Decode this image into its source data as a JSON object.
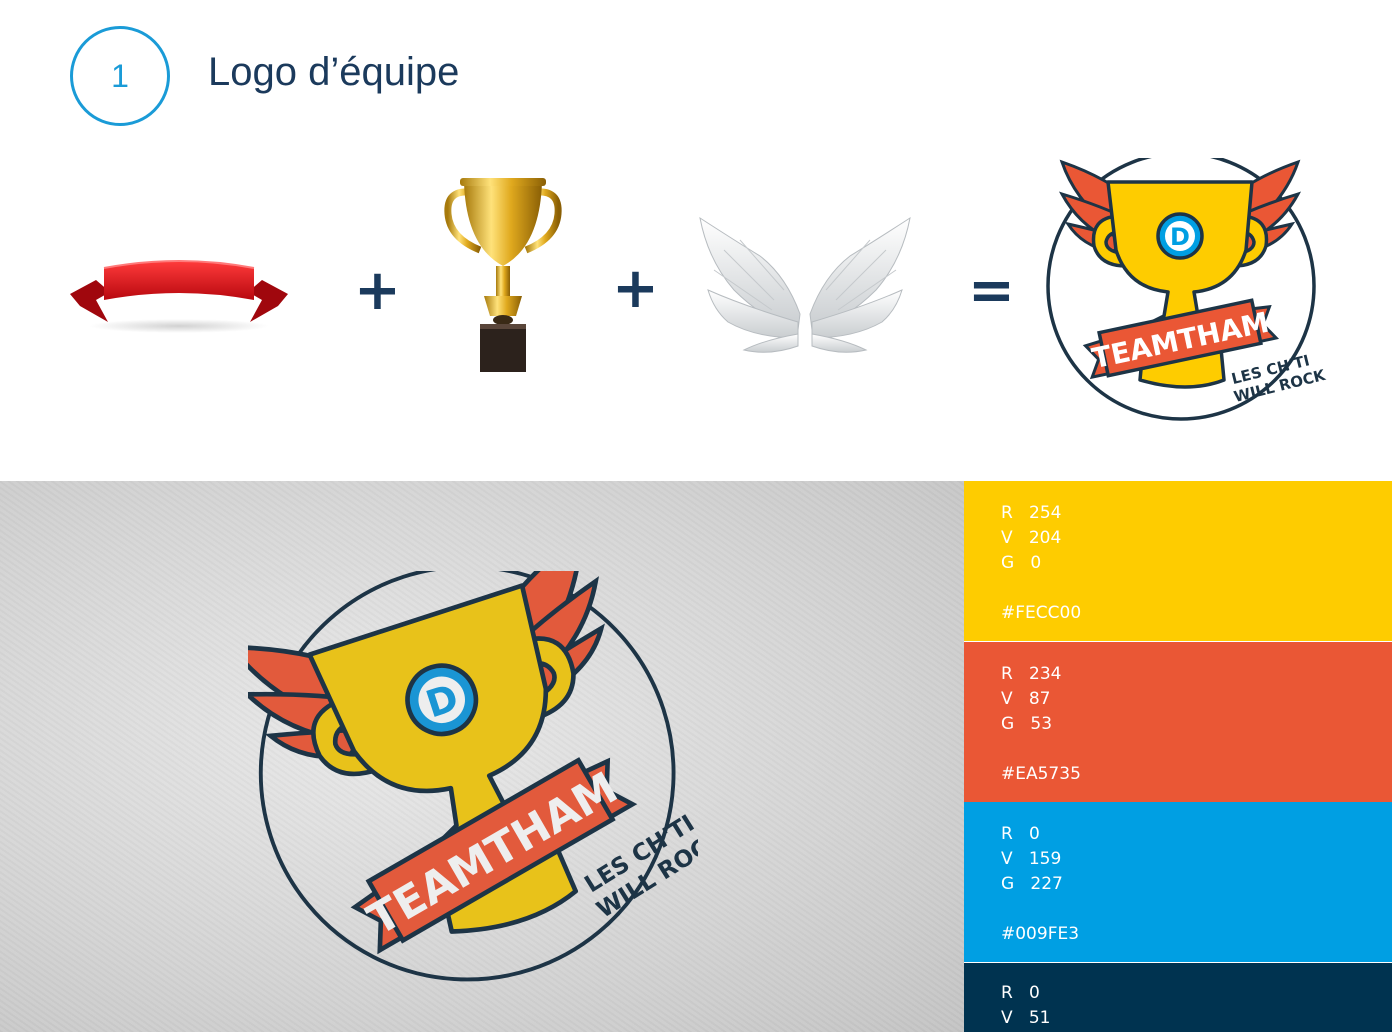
{
  "header": {
    "step_number": "1",
    "title": "Logo d’équipe"
  },
  "equation": {
    "plus1": "+",
    "plus2": "+",
    "equals": "="
  },
  "logo": {
    "badge_letter": "D",
    "banner_text": "TEAMTHAM",
    "tagline_line1": "LES CH'TI",
    "tagline_line2": "WILL ROCK"
  },
  "colors": {
    "yellow": "#FECC00",
    "orange": "#EA5735",
    "blue": "#009FE3",
    "navy": "#003350"
  },
  "palette": [
    {
      "r_label": "R",
      "r": "254",
      "v_label": "V",
      "v": "204",
      "g_label": "G",
      "g": "0",
      "hex": "#FECC00"
    },
    {
      "r_label": "R",
      "r": "234",
      "v_label": "V",
      "v": "87",
      "g_label": "G",
      "g": "53",
      "hex": "#EA5735"
    },
    {
      "r_label": "R",
      "r": "0",
      "v_label": "V",
      "v": "159",
      "g_label": "G",
      "g": "227",
      "hex": "#009FE3"
    },
    {
      "r_label": "R",
      "r": "0",
      "v_label": "V",
      "v": "51"
    }
  ]
}
